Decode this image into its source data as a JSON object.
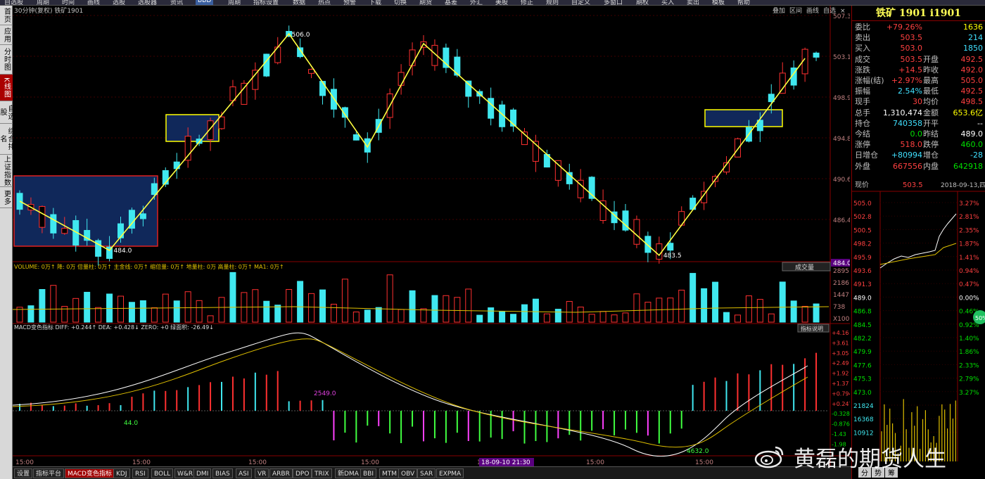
{
  "toolbar": {
    "items": [
      "自选股",
      "周期",
      "时间",
      "画线",
      "选股",
      "选股器",
      "资讯",
      "BBD",
      "周期",
      "指标设置",
      "数据",
      "热点",
      "预警",
      "下载",
      "切换",
      "期货",
      "基差",
      "外汇",
      "美股",
      "修正",
      "规则",
      "自定义",
      "多窗口",
      "期权",
      "买入",
      "卖出",
      "模板",
      "帮助"
    ]
  },
  "left_tabs": [
    "首页",
    "应用",
    "分时图",
    "K线图",
    "自选股",
    "综合排名",
    "上证指数",
    "更多"
  ],
  "chart": {
    "header": "30分钟(复权) 铁矿1901",
    "right_controls": [
      "叠加",
      "区间",
      "画线",
      "自选",
      "×"
    ],
    "price_labels": [
      "507.3",
      "503.1",
      "498.9",
      "494.8",
      "490.6",
      "486.4",
      "484.0"
    ],
    "current_price_tag": "484.0",
    "annotations": {
      "high": "506.0",
      "low_left": "484.0",
      "low_right": "483.5",
      "macd_top": "2549.0",
      "macd_left": "44.0",
      "macd_right": "4632.0"
    },
    "volume_header": "VOLUME: 0万↑ 降: 0万 倍量柱: 0万↑ 主金线: 0万↑ 缩倍量: 0万↑ 地量柱: 0万 高量柱: 0万↑ MA1: 0万↑",
    "volume_dropdown": "成交量",
    "volume_labels": [
      "2895",
      "2186",
      "1447",
      "738",
      "X100"
    ],
    "macd_header": "MACD变色指标 DIFF: +0.244↑ DEA: +0.428↓ ZERO: +0 绿面积: -26.49↓",
    "macd_button": "指标说明",
    "macd_labels": [
      "+4.16",
      "+3.61",
      "+3.05",
      "+2.49",
      "+1.92",
      "+1.37",
      "+0.794",
      "+0.247",
      "-0.328",
      "-0.876",
      "-1.43",
      "-1.98"
    ],
    "time_labels": [
      "15:00",
      "15:00",
      "15:00",
      "15:00",
      "15:00",
      "15:00",
      "15:00"
    ],
    "time_highlight": "18-09-10 21:30"
  },
  "chart_data": {
    "type": "candlestick",
    "title": "30分钟(复权) 铁矿1901",
    "ylim": [
      483,
      508
    ],
    "zigzag_points": [
      {
        "bar": 0,
        "price": 489.0
      },
      {
        "bar": 8,
        "price": 484.0
      },
      {
        "bar": 24,
        "price": 506.0
      },
      {
        "bar": 31,
        "price": 494.5
      },
      {
        "bar": 36,
        "price": 505.0
      },
      {
        "bar": 57,
        "price": 483.5
      },
      {
        "bar": 70,
        "price": 503.5
      }
    ]
  },
  "panel": {
    "title": "铁矿 1901 i1901",
    "rows": [
      {
        "l1": "委比",
        "v1": "+79.26%",
        "c1": "red",
        "v2": "1636",
        "c2": "yellow"
      },
      {
        "l1": "卖出",
        "v1": "503.5",
        "c1": "red",
        "v2": "214",
        "c2": "cyan"
      },
      {
        "l1": "买入",
        "v1": "503.0",
        "c1": "red",
        "v2": "1850",
        "c2": "cyan"
      },
      {
        "l1": "成交",
        "v1": "503.5",
        "c1": "red",
        "l2": "开盘",
        "v2": "492.5",
        "c2": "red"
      },
      {
        "l1": "涨跌",
        "v1": "+14.5",
        "c1": "red",
        "l2": "昨收",
        "v2": "492.0",
        "c2": "red"
      },
      {
        "l1": "涨幅(结)",
        "v1": "+2.97%",
        "c1": "red",
        "l2": "最高",
        "v2": "505.0",
        "c2": "red"
      },
      {
        "l1": "振幅",
        "v1": "2.54%",
        "c1": "cyan",
        "l2": "最低",
        "v2": "492.5",
        "c2": "red"
      },
      {
        "l1": "现手",
        "v1": "30",
        "c1": "red",
        "l2": "均价",
        "v2": "498.5",
        "c2": "red"
      },
      {
        "l1": "总手",
        "v1": "1,310,474",
        "c1": "white",
        "l2": "金额",
        "v2": "653.6亿",
        "c2": "yellow"
      },
      {
        "l1": "持仓",
        "v1": "740358",
        "c1": "cyan",
        "l2": "开平",
        "v2": "--",
        "c2": "white"
      },
      {
        "l1": "今结",
        "v1": "0.0",
        "c1": "green",
        "l2": "昨结",
        "v2": "489.0",
        "c2": "white"
      },
      {
        "l1": "涨停",
        "v1": "518.0",
        "c1": "red",
        "l2": "跌停",
        "v2": "460.0",
        "c2": "green"
      },
      {
        "l1": "日增仓",
        "v1": "+80994",
        "c1": "cyan",
        "l2": "增仓",
        "v2": "-28",
        "c2": "cyan"
      },
      {
        "l1": "外盘",
        "v1": "667556",
        "c1": "red",
        "l2": "内盘",
        "v2": "642918",
        "c2": "green"
      }
    ],
    "mini_header": {
      "label": "现价",
      "price": "503.5",
      "date": "2018-09-13,四"
    },
    "mini_left_labels": [
      "505.0",
      "502.8",
      "500.5",
      "498.2",
      "495.9",
      "493.6",
      "491.3",
      "489.0",
      "486.8",
      "484.5",
      "482.2",
      "479.9",
      "477.6",
      "475.3",
      "473.0",
      "21824",
      "16368",
      "10912"
    ],
    "mini_right_labels": [
      "3.27%",
      "2.81%",
      "2.35%",
      "1.87%",
      "1.41%",
      "0.94%",
      "0.47%",
      "0.00%",
      "0.46%",
      "0.92%",
      "1.40%",
      "1.86%",
      "2.33%",
      "2.79%",
      "3.27%"
    ],
    "badge": "50%"
  },
  "bottom_tabs": [
    "设置",
    "指标平台",
    "MACD变色指标",
    "KDJ",
    "RSI",
    "BOLL",
    "W&R",
    "DMI",
    "BIAS",
    "ASI",
    "VR",
    "ARBR",
    "DPO",
    "TRIX",
    "新DMA",
    "BBI",
    "MTM",
    "OBV",
    "SAR",
    "EXPMA"
  ],
  "right_bottom_tabs": [
    "分",
    "势",
    "筹"
  ],
  "watermark": "黄磊的期货人生"
}
